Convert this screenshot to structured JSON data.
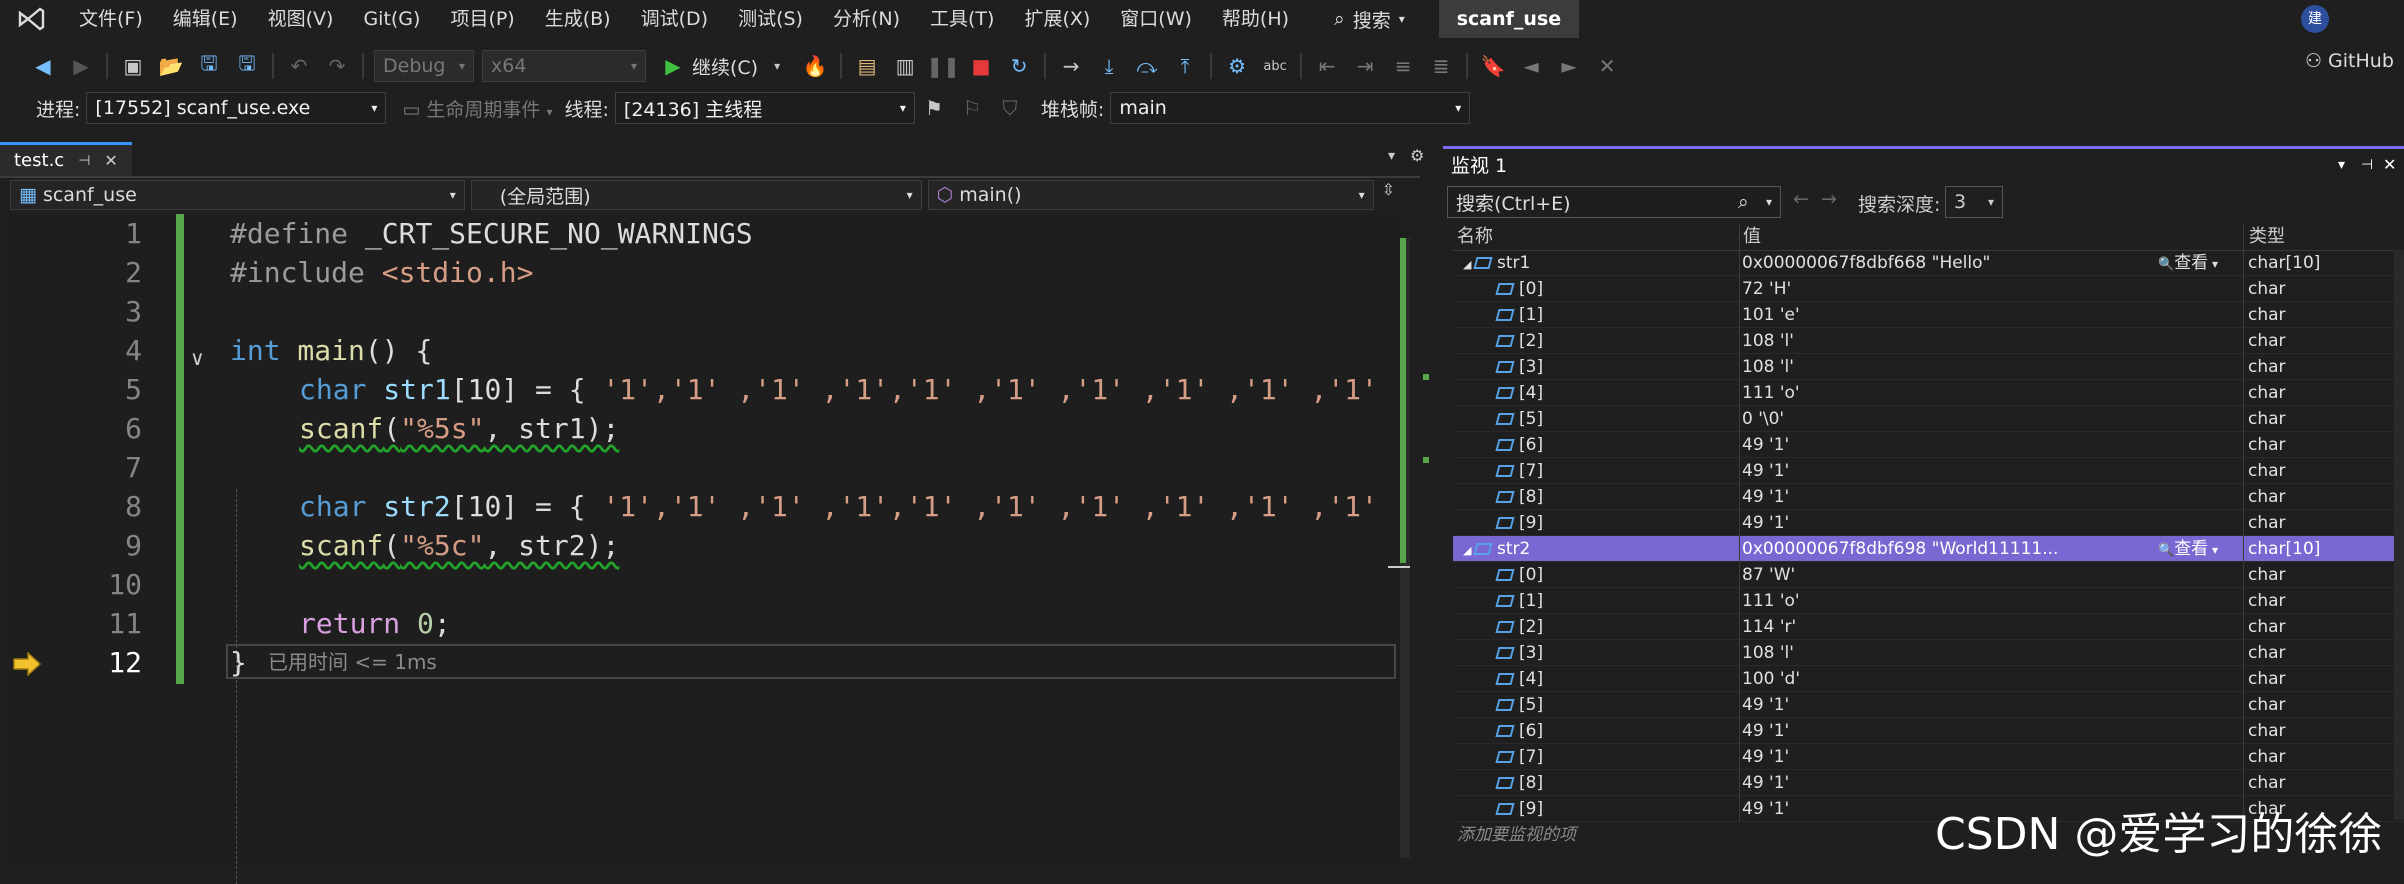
{
  "menu": [
    "文件(F)",
    "编辑(E)",
    "视图(V)",
    "Git(G)",
    "项目(P)",
    "生成(B)",
    "调试(D)",
    "测试(S)",
    "分析(N)",
    "工具(T)",
    "扩展(X)",
    "窗口(W)",
    "帮助(H)"
  ],
  "search_label": "搜索",
  "solution_name": "scanf_use",
  "avatar_initial": "建",
  "toolbar": {
    "config": "Debug",
    "platform": "x64",
    "continue_label": "继续(C)",
    "github_label": "GitHub"
  },
  "debug_location": {
    "process_label": "进程:",
    "process_value": "[17552] scanf_use.exe",
    "lifecycle_label": "生命周期事件",
    "thread_label": "线程:",
    "thread_value": "[24136] 主线程",
    "stackframe_label": "堆栈帧:",
    "stackframe_value": "main"
  },
  "editor": {
    "tab_name": "test.c",
    "nav_project": "scanf_use",
    "nav_scope": "(全局范围)",
    "nav_function": "main()",
    "lines": [
      {
        "n": "1"
      },
      {
        "n": "2"
      },
      {
        "n": "3"
      },
      {
        "n": "4"
      },
      {
        "n": "5"
      },
      {
        "n": "6"
      },
      {
        "n": "7"
      },
      {
        "n": "8"
      },
      {
        "n": "9"
      },
      {
        "n": "10"
      },
      {
        "n": "11"
      },
      {
        "n": "12"
      }
    ],
    "code": {
      "l1_pp": "#define",
      "l1_id": " _CRT_SECURE_NO_WARNINGS",
      "l2_pp": "#include",
      "l2_str": " <stdio.h>",
      "l4_kw": "int",
      "l4_fn": " main",
      "l4_rest": "() {",
      "l5_kw": "char",
      "l5_id": " str1",
      "l5_rest": "[10] = { ",
      "l5_vals": "'1','1' ,'1' ,'1','1' ,'1' ,'1' ,'1' ,'1' ,'1'",
      "l6_fn": "scanf",
      "l6_open": "(",
      "l6_str": "\"%5s\"",
      "l6_rest": ", str1);",
      "l8_kw": "char",
      "l8_id": " str2",
      "l8_rest": "[10] = { ",
      "l8_vals": "'1','1' ,'1' ,'1','1' ,'1' ,'1' ,'1' ,'1' ,'1'",
      "l9_fn": "scanf",
      "l9_open": "(",
      "l9_str": "\"%5c\"",
      "l9_rest": ", str2);",
      "l11_ret": "return",
      "l11_num": " 0",
      "l11_semi": ";",
      "l12_brace": "}",
      "l12_elapsed": "已用时间 <= 1ms"
    }
  },
  "watch": {
    "title": "监视 1",
    "search_placeholder": "搜索(Ctrl+E)",
    "depth_label": "搜索深度:",
    "depth_value": "3",
    "col_name": "名称",
    "col_value": "值",
    "col_type": "类型",
    "view_label": "查看",
    "add_hint": "添加要监视的项",
    "rows": [
      {
        "name": "str1",
        "value": "0x00000067f8dbf668 \"Hello\"",
        "type": "char[10]",
        "level": 0,
        "view": true
      },
      {
        "name": "[0]",
        "value": "72 'H'",
        "type": "char",
        "level": 1
      },
      {
        "name": "[1]",
        "value": "101 'e'",
        "type": "char",
        "level": 1
      },
      {
        "name": "[2]",
        "value": "108 'l'",
        "type": "char",
        "level": 1
      },
      {
        "name": "[3]",
        "value": "108 'l'",
        "type": "char",
        "level": 1
      },
      {
        "name": "[4]",
        "value": "111 'o'",
        "type": "char",
        "level": 1
      },
      {
        "name": "[5]",
        "value": "0 '\\0'",
        "type": "char",
        "level": 1
      },
      {
        "name": "[6]",
        "value": "49 '1'",
        "type": "char",
        "level": 1
      },
      {
        "name": "[7]",
        "value": "49 '1'",
        "type": "char",
        "level": 1
      },
      {
        "name": "[8]",
        "value": "49 '1'",
        "type": "char",
        "level": 1
      },
      {
        "name": "[9]",
        "value": "49 '1'",
        "type": "char",
        "level": 1
      },
      {
        "name": "str2",
        "value": "0x00000067f8dbf698 \"World11111...",
        "type": "char[10]",
        "level": 0,
        "view": true,
        "selected": true
      },
      {
        "name": "[0]",
        "value": "87 'W'",
        "type": "char",
        "level": 1
      },
      {
        "name": "[1]",
        "value": "111 'o'",
        "type": "char",
        "level": 1
      },
      {
        "name": "[2]",
        "value": "114 'r'",
        "type": "char",
        "level": 1
      },
      {
        "name": "[3]",
        "value": "108 'l'",
        "type": "char",
        "level": 1
      },
      {
        "name": "[4]",
        "value": "100 'd'",
        "type": "char",
        "level": 1
      },
      {
        "name": "[5]",
        "value": "49 '1'",
        "type": "char",
        "level": 1
      },
      {
        "name": "[6]",
        "value": "49 '1'",
        "type": "char",
        "level": 1
      },
      {
        "name": "[7]",
        "value": "49 '1'",
        "type": "char",
        "level": 1
      },
      {
        "name": "[8]",
        "value": "49 '1'",
        "type": "char",
        "level": 1
      },
      {
        "name": "[9]",
        "value": "49 '1'",
        "type": "char",
        "level": 1
      }
    ]
  },
  "watermark": "CSDN @爱学习的徐徐"
}
